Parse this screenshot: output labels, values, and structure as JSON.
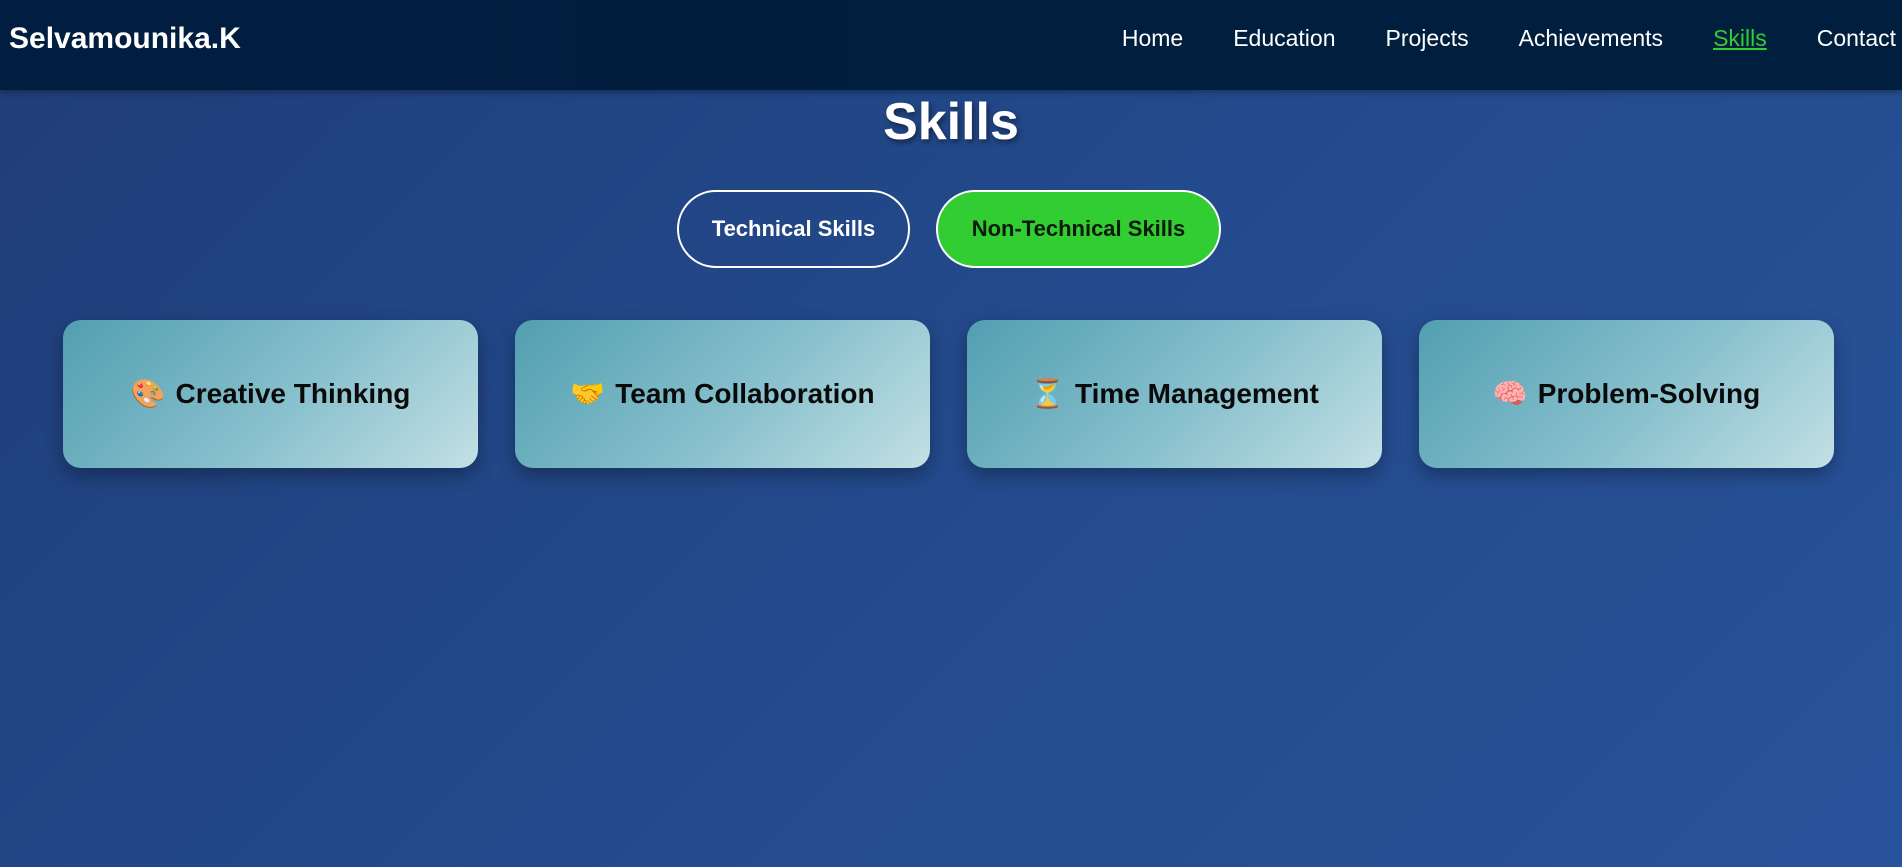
{
  "brand": "Selvamounika.K",
  "nav": {
    "items": [
      {
        "label": "Home"
      },
      {
        "label": "Education"
      },
      {
        "label": "Projects"
      },
      {
        "label": "Achievements"
      },
      {
        "label": "Skills",
        "active": true
      },
      {
        "label": "Contact"
      }
    ],
    "active_color": "#32cd32"
  },
  "section": {
    "title": "Skills"
  },
  "tabs": {
    "technical": "Technical Skills",
    "non_technical": "Non-Technical Skills",
    "selected": "non_technical",
    "selected_color": "#32cd32"
  },
  "cards": [
    {
      "icon": "🎨",
      "icon_name": "palette-icon",
      "label": "Creative Thinking"
    },
    {
      "icon": "🤝",
      "icon_name": "handshake-icon",
      "label": "Team Collaboration"
    },
    {
      "icon": "⏳",
      "icon_name": "hourglass-icon",
      "label": "Time Management"
    },
    {
      "icon": "🧠",
      "icon_name": "brain-icon",
      "label": "Problem-Solving"
    }
  ]
}
